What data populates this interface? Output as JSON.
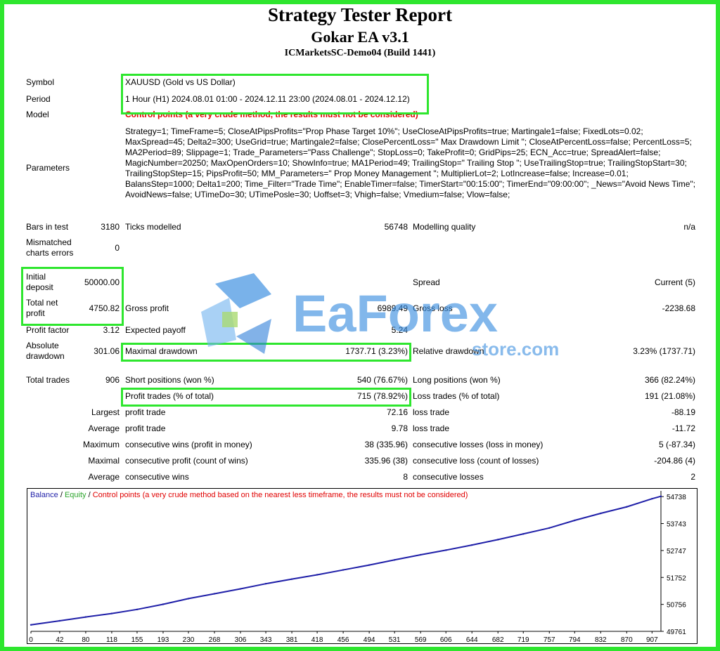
{
  "header": {
    "title": "Strategy Tester Report",
    "ea_name": "Gokar EA v3.1",
    "server": "ICMarketsSC-Demo04 (Build 1441)"
  },
  "labels": {
    "symbol": "Symbol",
    "period": "Period",
    "model": "Model",
    "parameters": "Parameters",
    "bars_in_test": "Bars in test",
    "ticks_modelled": "Ticks modelled",
    "modelling_quality": "Modelling quality",
    "mismatched_1": "Mismatched",
    "mismatched_2": "charts errors",
    "initial_1": "Initial",
    "initial_2": "deposit",
    "spread": "Spread",
    "netprofit_1": "Total net",
    "netprofit_2": "profit",
    "gross_profit": "Gross profit",
    "gross_loss": "Gross loss",
    "profit_factor": "Profit factor",
    "expected_payoff": "Expected payoff",
    "absdd_1": "Absolute",
    "absdd_2": "drawdown",
    "maximal_drawdown": "Maximal drawdown",
    "relative_drawdown": "Relative drawdown",
    "total_trades": "Total trades",
    "short_positions": "Short positions (won %)",
    "long_positions": "Long positions (won %)",
    "profit_trades": "Profit trades (% of total)",
    "loss_trades": "Loss trades (% of total)",
    "largest": "Largest",
    "average": "Average",
    "maximum": "Maximum",
    "maximal": "Maximal",
    "profit_trade": "profit trade",
    "loss_trade": "loss trade",
    "cons_wins_money": "consecutive wins (profit in money)",
    "cons_losses_money": "consecutive losses (loss in money)",
    "cons_profit_count": "consecutive profit (count of wins)",
    "cons_loss_count": "consecutive loss (count of losses)",
    "cons_wins": "consecutive wins",
    "cons_losses": "consecutive losses"
  },
  "values": {
    "symbol": "XAUUSD (Gold vs US Dollar)",
    "period": "1 Hour (H1) 2024.08.01 01:00 - 2024.12.11 23:00 (2024.08.01 - 2024.12.12)",
    "model": "Control points (a very crude method, the results must not be considered)",
    "parameters": "Strategy=1; TimeFrame=5; CloseAtPipsProfits=\"Prop Phase Target 10%\"; UseCloseAtPipsProfits=true; Martingale1=false; FixedLots=0.02; MaxSpread=45; Delta2=300; UseGrid=true; Martingale2=false; ClosePercentLoss=\" Max Drawdown Limit \"; CloseAtPercentLoss=false; PercentLoss=5; MA2Period=89; Slippage=1; Trade_Parameters=\"Pass Challenge\"; StopLoss=0; TakeProfit=0; GridPips=25; ECN_Acc=true; SpreadAlert=false; MagicNumber=20250; MaxOpenOrders=10; ShowInfo=true; MA1Period=49; TrailingStop=\" Trailing Stop \"; UseTrailingStop=true; TrailingStopStart=30; TrailingStopStep=15; PipsProfit=50; MM_Parameters=\" Prop Money Management \"; MultiplierLot=2; LotIncrease=false; Increase=0.01; BalansStep=1000; Delta1=200; Time_Filter=\"Trade Time\"; EnableTimer=false; TimerStart=\"00:15:00\"; TimerEnd=\"09:00:00\"; _News=\"Avoid News Time\"; AvoidNews=false; UTimeDo=30; UTimePosle=30; Uoffset=3; Vhigh=false; Vmedium=false; Vlow=false;",
    "bars_in_test": "3180",
    "ticks_modelled": "56748",
    "modelling_quality": "n/a",
    "mismatched": "0",
    "initial_deposit": "50000.00",
    "spread": "Current (5)",
    "total_net_profit": "4750.82",
    "gross_profit": "6989.49",
    "gross_loss": "-2238.68",
    "profit_factor": "3.12",
    "expected_payoff": "5.24",
    "absolute_drawdown": "301.06",
    "maximal_drawdown": "1737.71 (3.23%)",
    "relative_drawdown": "3.23% (1737.71)",
    "total_trades": "906",
    "short_positions": "540 (76.67%)",
    "long_positions": "366 (82.24%)",
    "profit_trades": "715 (78.92%)",
    "loss_trades": "191 (21.08%)",
    "largest_profit": "72.16",
    "largest_loss": "-88.19",
    "average_profit": "9.78",
    "average_loss": "-11.72",
    "max_cons_wins": "38 (335.96)",
    "max_cons_losses": "5 (-87.34)",
    "maximal_cons_profit": "335.96 (38)",
    "maximal_cons_loss": "-204.86 (4)",
    "avg_cons_wins": "8",
    "avg_cons_losses": "2"
  },
  "watermark": {
    "brand": "EaForex",
    "sub": "store.com"
  },
  "colors": {
    "highlight": "#2ee62e",
    "balance": "#1f1fa8",
    "equity": "#2ea52e",
    "control": "#e00000"
  },
  "chart_data": {
    "type": "line",
    "legend": [
      {
        "text": "Balance",
        "color": "#1f1fa8"
      },
      {
        "text": " / ",
        "color": "#000000"
      },
      {
        "text": "Equity",
        "color": "#2ea52e"
      },
      {
        "text": " / ",
        "color": "#000000"
      },
      {
        "text": "Control points (a very crude method based on the nearest less timeframe, the results must not be considered)",
        "color": "#e00000"
      }
    ],
    "x_ticks": [
      0,
      42,
      80,
      118,
      155,
      193,
      230,
      268,
      306,
      343,
      381,
      418,
      456,
      494,
      531,
      569,
      606,
      644,
      682,
      719,
      757,
      794,
      832,
      870,
      907
    ],
    "y_ticks": [
      54738,
      53743,
      52747,
      51752,
      50756,
      49761
    ],
    "xlim": [
      0,
      920
    ],
    "ylim": [
      49761,
      54950
    ],
    "series": [
      {
        "name": "Balance",
        "x": [
          0,
          42,
          80,
          118,
          155,
          193,
          230,
          268,
          306,
          343,
          381,
          418,
          456,
          494,
          531,
          569,
          606,
          644,
          682,
          719,
          757,
          794,
          832,
          870,
          907,
          920
        ],
        "y": [
          50000,
          50150,
          50290,
          50420,
          50570,
          50760,
          50970,
          51150,
          51330,
          51520,
          51690,
          51850,
          52030,
          52210,
          52400,
          52590,
          52760,
          52950,
          53150,
          53360,
          53580,
          53860,
          54120,
          54360,
          54660,
          54750
        ]
      }
    ]
  }
}
